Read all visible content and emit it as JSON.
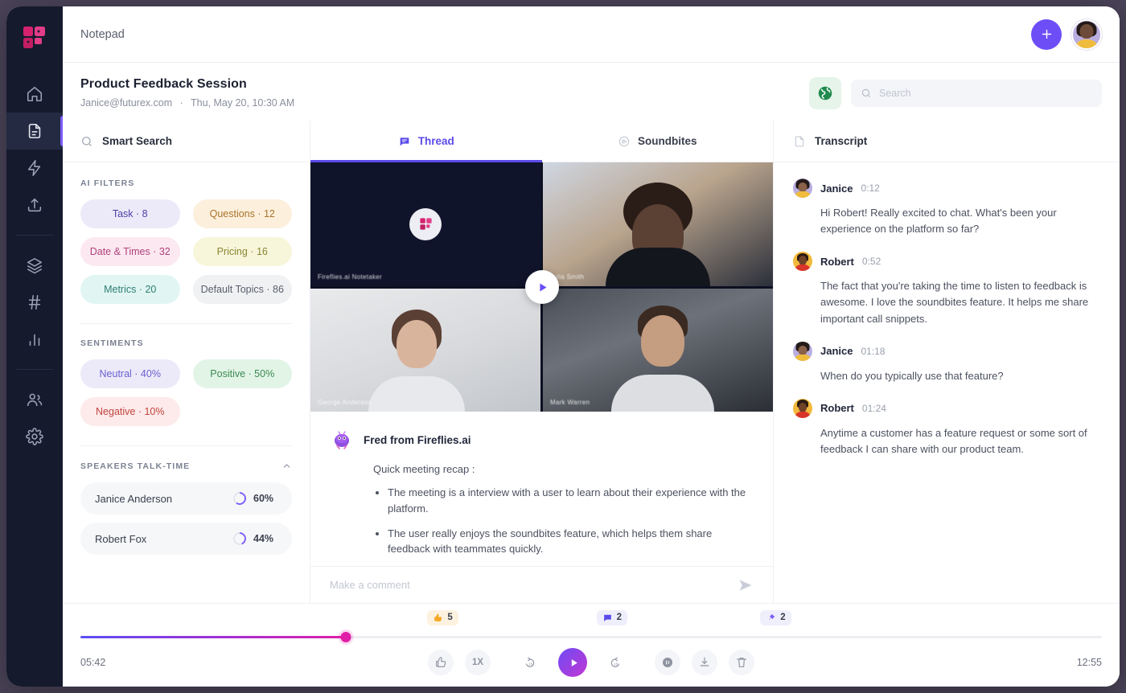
{
  "sidebar": {
    "logo_name": "fireflies-logo",
    "items": [
      {
        "name": "home",
        "icon": "home-icon"
      },
      {
        "name": "notepad",
        "icon": "document-icon",
        "active": true
      },
      {
        "name": "automation",
        "icon": "lightning-icon"
      },
      {
        "name": "upload",
        "icon": "upload-icon"
      },
      {
        "name": "library",
        "icon": "layers-icon"
      },
      {
        "name": "channels",
        "icon": "hash-icon"
      },
      {
        "name": "analytics",
        "icon": "bar-chart-icon"
      },
      {
        "name": "teammates",
        "icon": "users-icon"
      },
      {
        "name": "settings",
        "icon": "gear-icon"
      }
    ]
  },
  "topbar": {
    "title": "Notepad",
    "add_button_label": "+",
    "avatar_name": "user-avatar"
  },
  "meeting": {
    "title": "Product Feedback Session",
    "owner_email": "Janice@futurex.com",
    "separator": "·",
    "datetime": "Thu, May 20, 10:30 AM"
  },
  "search": {
    "placeholder": "Search",
    "value": ""
  },
  "smart_search": {
    "label": "Smart Search"
  },
  "ai_filters": {
    "section_label": "AI FILTERS",
    "chips": [
      {
        "label": "Task · 8",
        "bg": "#eceaf9",
        "color": "#4c3fa8"
      },
      {
        "label": "Questions · 12",
        "bg": "#fcefdc",
        "color": "#a8742a"
      },
      {
        "label": "Date & Times · 32",
        "bg": "#fce8f1",
        "color": "#b0427c"
      },
      {
        "label": "Pricing · 16",
        "bg": "#f7f6db",
        "color": "#8a8530"
      },
      {
        "label": "Metrics · 20",
        "bg": "#e1f6f3",
        "color": "#2e7d72"
      },
      {
        "label": "Default Topics · 86",
        "bg": "#f0f1f3",
        "color": "#5a5f6e"
      }
    ]
  },
  "sentiments": {
    "section_label": "SENTIMENTS",
    "chips": [
      {
        "label": "Neutral · 40%",
        "bg": "#eceaf9",
        "color": "#6a5fd0"
      },
      {
        "label": "Positive · 50%",
        "bg": "#e2f4e6",
        "color": "#3b8a52"
      },
      {
        "label": "Negative · 10%",
        "bg": "#fdeaea",
        "color": "#c0453f"
      }
    ]
  },
  "speakers": {
    "section_label": "SPEAKERS TALK-TIME",
    "rows": [
      {
        "name": "Janice Anderson",
        "percent": "60%",
        "value": 60
      },
      {
        "name": "Robert Fox",
        "percent": "44%",
        "value": 44
      }
    ]
  },
  "tabs": [
    {
      "label": "Thread",
      "icon": "chat-icon",
      "active": true
    },
    {
      "label": "Soundbites",
      "icon": "soundwave-icon",
      "active": false
    }
  ],
  "transcript_tab": {
    "label": "Transcript",
    "icon": "document-icon"
  },
  "video": {
    "play_overlay_name": "play-overlay-button",
    "tiles": [
      {
        "name": "fireflies-notetaker"
      },
      {
        "name": "participant-top-right"
      },
      {
        "name": "participant-bottom-left"
      },
      {
        "name": "participant-bottom-right"
      }
    ]
  },
  "recap": {
    "author": "Fred from Fireflies.ai",
    "intro": "Quick meeting recap :",
    "bullets": [
      "The meeting is a interview with a user to learn about their experience with the platform.",
      "The user really enjoys the soundbites feature, which helps them share feedback with teammates quickly."
    ]
  },
  "comment": {
    "placeholder": "Make a comment",
    "value": ""
  },
  "transcript": [
    {
      "speaker": "Janice",
      "avatar": "janice",
      "time": "0:12",
      "text": "Hi Robert! Really excited to chat. What's been your experience on the platform so far?"
    },
    {
      "speaker": "Robert",
      "avatar": "robert",
      "time": "0:52",
      "text": "The fact that you're taking the time to listen to feedback is awesome. I love the soundbites feature. It helps me share important call snippets."
    },
    {
      "speaker": "Janice",
      "avatar": "janice",
      "time": "01:18",
      "text": "When do you typically use that feature?"
    },
    {
      "speaker": "Robert",
      "avatar": "robert",
      "time": "01:24",
      "text": "Anytime a customer has a feature request or some sort of feedback I can share with our product team."
    }
  ],
  "player": {
    "badges": [
      {
        "icon": "thumbs-up-icon",
        "count": "5",
        "left_pct": 34.5,
        "bg": "#fdf2e0",
        "color": "#3a3f4d",
        "icon_color": "#f5a623"
      },
      {
        "icon": "comment-icon",
        "count": "2",
        "left_pct": 50.5,
        "bg": "#efeefb",
        "color": "#3a3f4d",
        "icon_color": "#5b4bea"
      },
      {
        "icon": "pin-icon",
        "count": "2",
        "left_pct": 66.0,
        "bg": "#efeefb",
        "color": "#3a3f4d",
        "icon_color": "#7b5cfa"
      }
    ],
    "progress_pct": 26,
    "current_time": "05:42",
    "total_time": "12:55",
    "speed_label": "1X",
    "controls": [
      {
        "name": "reaction-button",
        "icon": "thumbs-up-icon"
      },
      {
        "name": "speed-button",
        "icon": "text",
        "label": "1X"
      },
      {
        "name": "rewind-button",
        "icon": "rewind-15-icon"
      },
      {
        "name": "play-button",
        "icon": "play-icon"
      },
      {
        "name": "forward-button",
        "icon": "forward-15-icon"
      },
      {
        "name": "volume-button",
        "icon": "volume-icon"
      },
      {
        "name": "download-button",
        "icon": "download-icon"
      },
      {
        "name": "delete-button",
        "icon": "trash-icon"
      }
    ]
  },
  "colors": {
    "accent_purple": "#6d4df6",
    "accent_pink": "#e01fa8",
    "sidebar_bg": "#151a2d",
    "page_bg": "#4b4459"
  }
}
